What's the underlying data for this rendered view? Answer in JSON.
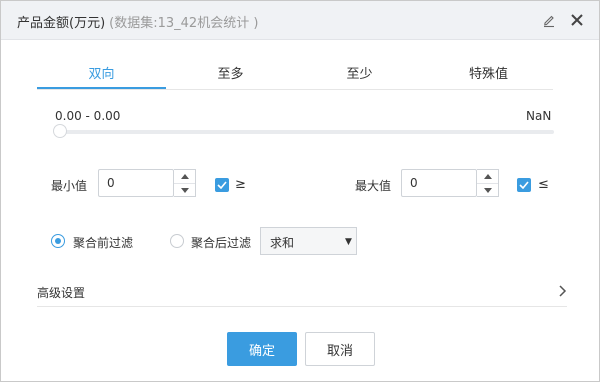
{
  "dialog": {
    "title": "产品金额(万元)",
    "subtitle": "(数据集:13_42机会统计 )"
  },
  "tabs": [
    {
      "label": "双向",
      "active": true
    },
    {
      "label": "至多",
      "active": false
    },
    {
      "label": "至少",
      "active": false
    },
    {
      "label": "特殊值",
      "active": false
    }
  ],
  "slider": {
    "range_text": "0.00 - 0.00",
    "max_text": "NaN"
  },
  "min": {
    "label": "最小值",
    "value": "0",
    "checked": true,
    "operator": "≥"
  },
  "max": {
    "label": "最大值",
    "value": "0",
    "checked": true,
    "operator": "≤"
  },
  "aggregation": {
    "before_label": "聚合前过滤",
    "after_label": "聚合后过滤",
    "selected": "before",
    "function_value": "求和"
  },
  "advanced": {
    "label": "高级设置"
  },
  "buttons": {
    "ok": "确定",
    "cancel": "取消"
  },
  "colors": {
    "accent": "#3a9ce0",
    "titlebar_bg": "#f0f2f5"
  }
}
